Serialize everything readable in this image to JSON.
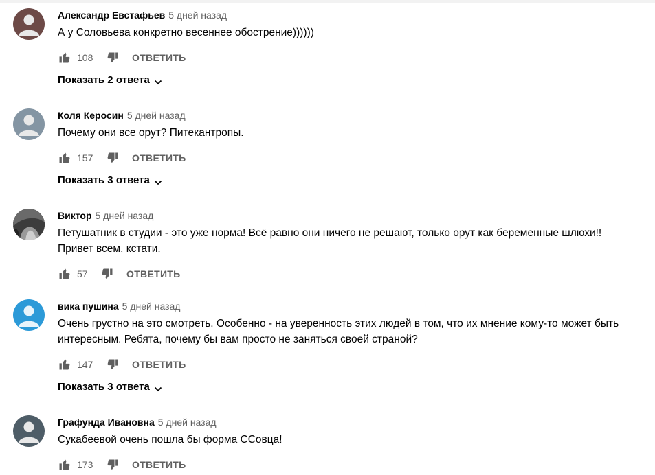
{
  "comments": [
    {
      "author": "Александр Евстафьев",
      "time": "5 дней назад",
      "lines": [
        "А у Соловьева конкретно весеннее обострение))))))"
      ],
      "likes": "108",
      "reply_label": "ОТВЕТИТЬ",
      "show_replies": "Показать 2 ответа",
      "avatar_color": "#6d4a47"
    },
    {
      "author": "Коля Керосин",
      "time": "5 дней назад",
      "lines": [
        "Почему они все орут? Питекантропы."
      ],
      "likes": "157",
      "reply_label": "ОТВЕТИТЬ",
      "show_replies": "Показать 3 ответа",
      "avatar_color": "#8495a3"
    },
    {
      "author": "Виктор",
      "time": "5 дней назад",
      "lines": [
        "Петушатник в студии - это уже норма! Всё равно они ничего не решают, только орут как беременные шлюхи!!",
        "Привет всем, кстати."
      ],
      "likes": "57",
      "reply_label": "ОТВЕТИТЬ",
      "avatar_color": "#4a4a4a"
    },
    {
      "author": "вика пушина",
      "time": "5 дней назад",
      "lines": [
        "Очень грустно на это смотреть. Особенно - на уверенность этих людей в том, что их мнение кому-то может быть",
        "интересным. Ребята, почему бы вам просто не заняться своей страной?"
      ],
      "likes": "147",
      "reply_label": "ОТВЕТИТЬ",
      "show_replies": "Показать 3 ответа",
      "avatar_color": "#2c9ad8"
    },
    {
      "author": "Графунда Ивановна",
      "time": "5 дней назад",
      "lines": [
        "Сукабеевой очень пошла бы форма ССовца!"
      ],
      "likes": "173",
      "reply_label": "ОТВЕТИТЬ",
      "avatar_color": "#4e5d67"
    }
  ],
  "colors": {
    "secondary_text": "#606060",
    "primary_text": "#030303"
  },
  "icons": {
    "like": "thumbs-up-icon",
    "dislike": "thumbs-down-icon",
    "expand": "chevron-down-icon"
  }
}
